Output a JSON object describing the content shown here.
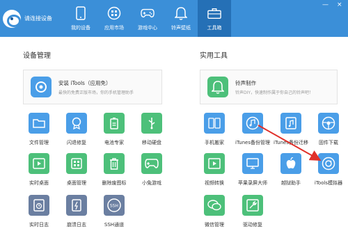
{
  "topbar": {
    "device_status": "请连接设备",
    "nav": [
      {
        "label": "我的设备",
        "icon": "phone-icon"
      },
      {
        "label": "应用市场",
        "icon": "grid-icon"
      },
      {
        "label": "游戏中心",
        "icon": "gamepad-icon"
      },
      {
        "label": "铃声壁纸",
        "icon": "bell-icon"
      },
      {
        "label": "工具箱",
        "icon": "toolbox-icon"
      }
    ],
    "window_controls": {
      "minimize": "—",
      "close": "×"
    }
  },
  "device_management": {
    "title": "设备管理",
    "banner": {
      "title": "安装 iTools（应用免）",
      "subtitle": "最快的免费正版市场，你的手机管理助手"
    },
    "tiles": [
      {
        "label": "文件管理",
        "icon": "folder-icon"
      },
      {
        "label": "闪退修复",
        "icon": "medal-icon"
      },
      {
        "label": "电池专家",
        "icon": "battery-icon"
      },
      {
        "label": "移动硬盘",
        "icon": "usb-icon"
      },
      {
        "label": "实时桌面",
        "icon": "play-icon"
      },
      {
        "label": "桌面管理",
        "icon": "apps-icon"
      },
      {
        "label": "删除废图标",
        "icon": "trash-icon"
      },
      {
        "label": "小兔游戏",
        "icon": "controller-icon"
      },
      {
        "label": "实时日志",
        "icon": "clock-icon"
      },
      {
        "label": "崩溃日志",
        "icon": "bolt-icon"
      },
      {
        "label": "SSH通道",
        "icon": "ssh-icon"
      }
    ]
  },
  "utilities": {
    "title": "实用工具",
    "banner": {
      "title": "铃声制作",
      "subtitle": "铃声DIY，快速制作属于你自己的铃声吧！"
    },
    "tiles": [
      {
        "label": "手机搬家",
        "icon": "transfer-icon"
      },
      {
        "label": "iTunes备份管理",
        "icon": "music-disc-icon"
      },
      {
        "label": "iTunes备份迁移",
        "icon": "music-note-icon"
      },
      {
        "label": "固件下载",
        "icon": "steering-icon"
      },
      {
        "label": "视频转换",
        "icon": "film-icon"
      },
      {
        "label": "苹果录屏大师",
        "icon": "screen-record-icon"
      },
      {
        "label": "越狱助手",
        "icon": "apple-icon"
      },
      {
        "label": "iTools模拟器",
        "icon": "simulator-icon"
      },
      {
        "label": "微信管理",
        "icon": "wechat-icon"
      },
      {
        "label": "驱动修复",
        "icon": "wrench-icon"
      }
    ]
  },
  "colors": {
    "topbar": "#3b8fd8",
    "active_tab": "#2570b6",
    "blue": "#4a9ee8",
    "green": "#4dc07a",
    "gray": "#6b7fa1",
    "arrow": "#e0302a"
  }
}
